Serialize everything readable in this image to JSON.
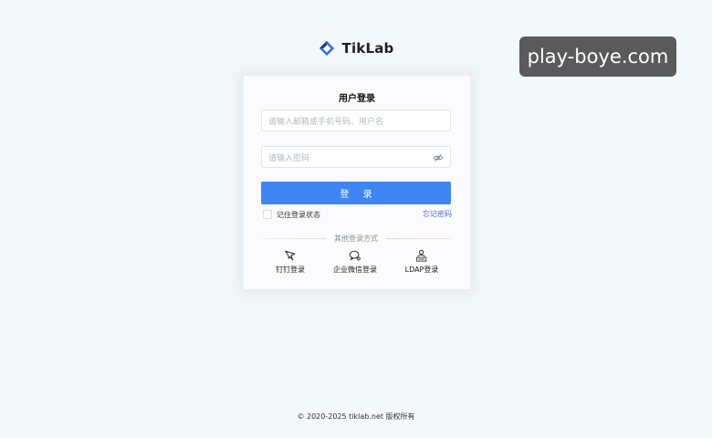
{
  "brand": {
    "name": "TikLab",
    "logo_icon": "tiklab-logo-icon"
  },
  "watermark": {
    "text": "play-boye.com"
  },
  "login": {
    "title": "用户登录",
    "username_placeholder": "请输入邮箱或手机号码、用户名",
    "username_value": "",
    "password_placeholder": "请输入密码",
    "password_value": "",
    "password_toggle_icon": "eye-off-icon",
    "submit_label": "登 录",
    "remember_label": "记住登录状态",
    "forgot_label": "忘记密码",
    "other_methods_label": "其他登录方式",
    "methods": [
      {
        "label": "钉钉登录",
        "icon": "dingtalk-icon"
      },
      {
        "label": "企业微信登录",
        "icon": "wecom-icon"
      },
      {
        "label": "LDAP登录",
        "icon": "ldap-icon"
      }
    ]
  },
  "colors": {
    "primary": "#3f86f4",
    "link": "#4a6cd6",
    "background": "#f3f8fa"
  },
  "footer": {
    "copyright": "© 2020-2025 tiklab.net 版权所有"
  }
}
